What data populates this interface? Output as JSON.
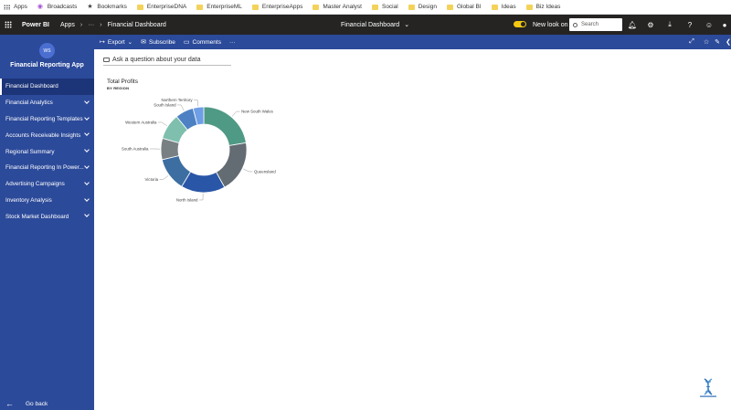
{
  "bookmarks_bar": {
    "items": [
      {
        "label": "Apps",
        "icon": "apps-grid-icon"
      },
      {
        "label": "Broadcasts",
        "icon": "podcast-icon"
      },
      {
        "label": "Bookmarks",
        "icon": "star-icon"
      },
      {
        "label": "EnterpriseDNA",
        "icon": "folder-icon"
      },
      {
        "label": "EnterpriseML",
        "icon": "folder-icon"
      },
      {
        "label": "EnterpriseApps",
        "icon": "folder-icon"
      },
      {
        "label": "Master Analyst",
        "icon": "folder-icon"
      },
      {
        "label": "Social",
        "icon": "folder-icon"
      },
      {
        "label": "Design",
        "icon": "folder-icon"
      },
      {
        "label": "Global BI",
        "icon": "folder-icon"
      },
      {
        "label": "Ideas",
        "icon": "folder-icon"
      },
      {
        "label": "Biz Ideas",
        "icon": "folder-icon"
      }
    ]
  },
  "header": {
    "brand": "Power BI",
    "crumb_apps": "Apps",
    "crumb_more": "···",
    "crumb_current": "Financial Dashboard",
    "center_title": "Financial Dashboard",
    "new_look_label": "New look on",
    "search_placeholder": "Search",
    "colors": {
      "bar": "#252423",
      "toggle": "#f2c811"
    }
  },
  "sidebar": {
    "avatar_initials": "WS",
    "app_name": "Financial Reporting App",
    "items": [
      {
        "label": "Financial Dashboard",
        "active": true,
        "expandable": false
      },
      {
        "label": "Financial Analytics",
        "active": false,
        "expandable": true
      },
      {
        "label": "Financial Reporting Templates",
        "active": false,
        "expandable": true
      },
      {
        "label": "Accounts Receivable Insights",
        "active": false,
        "expandable": true
      },
      {
        "label": "Regional Summary",
        "active": false,
        "expandable": true
      },
      {
        "label": "Financial Reporting In Power...",
        "active": false,
        "expandable": true
      },
      {
        "label": "Advertising Campaigns",
        "active": false,
        "expandable": true
      },
      {
        "label": "Inventory Analysis",
        "active": false,
        "expandable": true
      },
      {
        "label": "Stock Market Dashboard",
        "active": false,
        "expandable": true
      }
    ],
    "go_back": "Go back",
    "color": "#2c4a9a"
  },
  "toolbar": {
    "export": "Export",
    "subscribe": "Subscribe",
    "comments": "Comments",
    "more": "···"
  },
  "canvas": {
    "qna_placeholder": "Ask a question about your data"
  },
  "chart_data": {
    "type": "pie",
    "title": "Total Profits",
    "subtitle": "BY REGION",
    "donut": true,
    "categories": [
      "New South Wales",
      "Queensland",
      "North Island",
      "Victoria",
      "South Australia",
      "Western Australia",
      "South Island",
      "Northern Territory"
    ],
    "values": [
      19.5,
      17.0,
      14.5,
      11.0,
      7.0,
      8.5,
      6.0,
      3.5
    ],
    "colors": [
      "#4f9a84",
      "#636b73",
      "#2a56a8",
      "#3d6ea2",
      "#788084",
      "#7fbfae",
      "#4d81c4",
      "#6e9ee6"
    ]
  }
}
